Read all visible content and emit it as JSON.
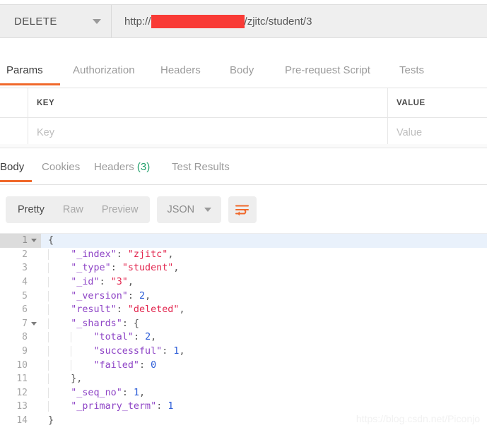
{
  "request_bar": {
    "method": "DELETE",
    "url_prefix": "http://",
    "url_suffix": "/zjitc/student/3",
    "redaction_color": "#f93b36"
  },
  "request_tabs": [
    {
      "label": "Params",
      "active": true
    },
    {
      "label": "Authorization",
      "active": false
    },
    {
      "label": "Headers",
      "active": false
    },
    {
      "label": "Body",
      "active": false
    },
    {
      "label": "Pre-request Script",
      "active": false
    },
    {
      "label": "Tests",
      "active": false
    }
  ],
  "params_table": {
    "headers": {
      "key": "KEY",
      "value": "VALUE"
    },
    "row": {
      "key_placeholder": "Key",
      "value_placeholder": "Value"
    }
  },
  "response_tabs": [
    {
      "label": "Body",
      "active": true,
      "count": ""
    },
    {
      "label": "Cookies",
      "active": false,
      "count": ""
    },
    {
      "label": "Headers",
      "active": false,
      "count": "(3)"
    },
    {
      "label": "Test Results",
      "active": false,
      "count": ""
    }
  ],
  "view_toolbar": {
    "segments": [
      {
        "label": "Pretty",
        "active": true
      },
      {
        "label": "Raw",
        "active": false
      },
      {
        "label": "Preview",
        "active": false
      }
    ],
    "format": "JSON",
    "wrap_icon": "word-wrap-icon",
    "accent_color": "#f0682a"
  },
  "response_body": {
    "language": "json",
    "active_line": 1,
    "lines": [
      {
        "n": "1",
        "fold": true,
        "indent": 0,
        "tokens": [
          {
            "t": "{",
            "c": "p"
          }
        ]
      },
      {
        "n": "2",
        "fold": false,
        "indent": 1,
        "tokens": [
          {
            "t": "\"_index\"",
            "c": "k"
          },
          {
            "t": ": ",
            "c": "p"
          },
          {
            "t": "\"zjitc\"",
            "c": "s"
          },
          {
            "t": ",",
            "c": "p"
          }
        ]
      },
      {
        "n": "3",
        "fold": false,
        "indent": 1,
        "tokens": [
          {
            "t": "\"_type\"",
            "c": "k"
          },
          {
            "t": ": ",
            "c": "p"
          },
          {
            "t": "\"student\"",
            "c": "s"
          },
          {
            "t": ",",
            "c": "p"
          }
        ]
      },
      {
        "n": "4",
        "fold": false,
        "indent": 1,
        "tokens": [
          {
            "t": "\"_id\"",
            "c": "k"
          },
          {
            "t": ": ",
            "c": "p"
          },
          {
            "t": "\"3\"",
            "c": "s"
          },
          {
            "t": ",",
            "c": "p"
          }
        ]
      },
      {
        "n": "5",
        "fold": false,
        "indent": 1,
        "tokens": [
          {
            "t": "\"_version\"",
            "c": "k"
          },
          {
            "t": ": ",
            "c": "p"
          },
          {
            "t": "2",
            "c": "n"
          },
          {
            "t": ",",
            "c": "p"
          }
        ]
      },
      {
        "n": "6",
        "fold": false,
        "indent": 1,
        "tokens": [
          {
            "t": "\"result\"",
            "c": "k"
          },
          {
            "t": ": ",
            "c": "p"
          },
          {
            "t": "\"deleted\"",
            "c": "s"
          },
          {
            "t": ",",
            "c": "p"
          }
        ]
      },
      {
        "n": "7",
        "fold": true,
        "indent": 1,
        "tokens": [
          {
            "t": "\"_shards\"",
            "c": "k"
          },
          {
            "t": ": {",
            "c": "p"
          }
        ]
      },
      {
        "n": "8",
        "fold": false,
        "indent": 2,
        "tokens": [
          {
            "t": "\"total\"",
            "c": "k"
          },
          {
            "t": ": ",
            "c": "p"
          },
          {
            "t": "2",
            "c": "n"
          },
          {
            "t": ",",
            "c": "p"
          }
        ]
      },
      {
        "n": "9",
        "fold": false,
        "indent": 2,
        "tokens": [
          {
            "t": "\"successful\"",
            "c": "k"
          },
          {
            "t": ": ",
            "c": "p"
          },
          {
            "t": "1",
            "c": "n"
          },
          {
            "t": ",",
            "c": "p"
          }
        ]
      },
      {
        "n": "10",
        "fold": false,
        "indent": 2,
        "tokens": [
          {
            "t": "\"failed\"",
            "c": "k"
          },
          {
            "t": ": ",
            "c": "p"
          },
          {
            "t": "0",
            "c": "n"
          }
        ]
      },
      {
        "n": "11",
        "fold": false,
        "indent": 1,
        "tokens": [
          {
            "t": "},",
            "c": "p"
          }
        ]
      },
      {
        "n": "12",
        "fold": false,
        "indent": 1,
        "tokens": [
          {
            "t": "\"_seq_no\"",
            "c": "k"
          },
          {
            "t": ": ",
            "c": "p"
          },
          {
            "t": "1",
            "c": "n"
          },
          {
            "t": ",",
            "c": "p"
          }
        ]
      },
      {
        "n": "13",
        "fold": false,
        "indent": 1,
        "tokens": [
          {
            "t": "\"_primary_term\"",
            "c": "k"
          },
          {
            "t": ": ",
            "c": "p"
          },
          {
            "t": "1",
            "c": "n"
          }
        ]
      },
      {
        "n": "14",
        "fold": false,
        "indent": 0,
        "tokens": [
          {
            "t": "}",
            "c": "p"
          }
        ]
      }
    ]
  },
  "watermark": "https://blog.csdn.net/Piconjo"
}
